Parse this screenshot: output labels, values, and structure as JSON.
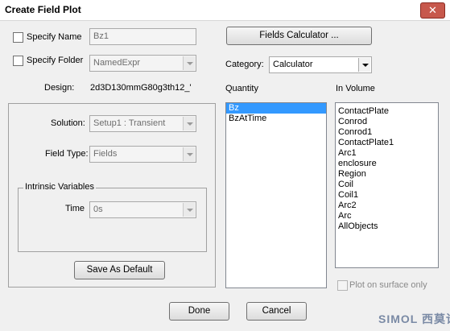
{
  "window": {
    "title": "Create Field Plot",
    "close_glyph": "✕"
  },
  "specify_name": {
    "label": "Specify Name",
    "value": "Bz1"
  },
  "specify_folder": {
    "label": "Specify Folder",
    "value": "NamedExpr"
  },
  "design": {
    "label": "Design:",
    "value": "2d3D130mmG80g3th12_'"
  },
  "fields_calculator_label": "Fields Calculator ...",
  "category": {
    "label": "Category:",
    "value": "Calculator"
  },
  "solution": {
    "label": "Solution:",
    "value": "Setup1 : Transient"
  },
  "field_type": {
    "label": "Field Type:",
    "value": "Fields"
  },
  "intrinsic": {
    "label": "Intrinsic Variables",
    "time_label": "Time",
    "time_value": "0s"
  },
  "save_default_label": "Save As Default",
  "quantity": {
    "label": "Quantity",
    "items": [
      "Bz",
      "BzAtTime"
    ],
    "selected": 0
  },
  "in_volume": {
    "label": "In Volume",
    "items": [
      "ContactPlate",
      "Conrod",
      "Conrod1",
      "ContactPlate1",
      "Arc1",
      "enclosure",
      "Region",
      "Coil",
      "Coil1",
      "Arc2",
      "Arc",
      "AllObjects"
    ]
  },
  "plot_on_surface": {
    "label": "Plot on surface only"
  },
  "done_label": "Done",
  "cancel_label": "Cancel",
  "watermark": "SIMOL 西莫论坛"
}
